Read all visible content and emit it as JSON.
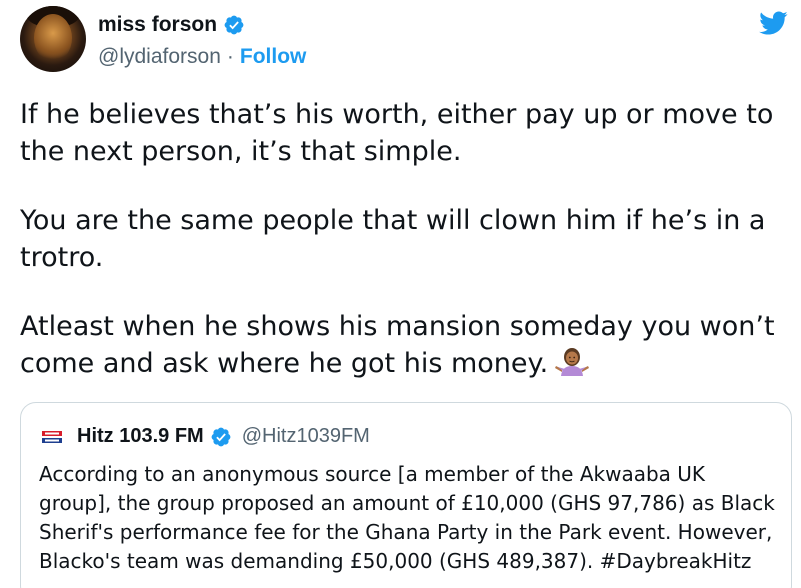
{
  "tweet": {
    "author": {
      "display_name": "miss forson",
      "handle": "@lydiaforson",
      "verified": true,
      "follow_label": "Follow",
      "separator": "·"
    },
    "body": [
      "If he believes that’s his worth, either pay up or move to the next person, it’s that simple.",
      "You are the same people that will clown him if he’s in a trotro.",
      "Atleast when he shows his mansion someday you won’t come and ask where he got his money."
    ],
    "emoji": "woman-shrugging-emoji",
    "brand_icon": "twitter-bird-icon"
  },
  "quoted_tweet": {
    "author": {
      "display_name": "Hitz 103.9 FM",
      "handle": "@Hitz1039FM",
      "verified": true,
      "logo": "hitz-logo-icon"
    },
    "body": "According to an anonymous source [a member of the Akwaaba UK group], the group proposed an amount of £10,000 (GHS 97,786) as Black Sherif's performance fee for the Ghana Party in the Park event. However, Blacko's team was demanding £50,000 (GHS 489,387). #DaybreakHitz"
  },
  "colors": {
    "link_blue": "#1d9bf0",
    "text": "#0f1419",
    "secondary_text": "#536471",
    "border": "#cfd9de"
  }
}
